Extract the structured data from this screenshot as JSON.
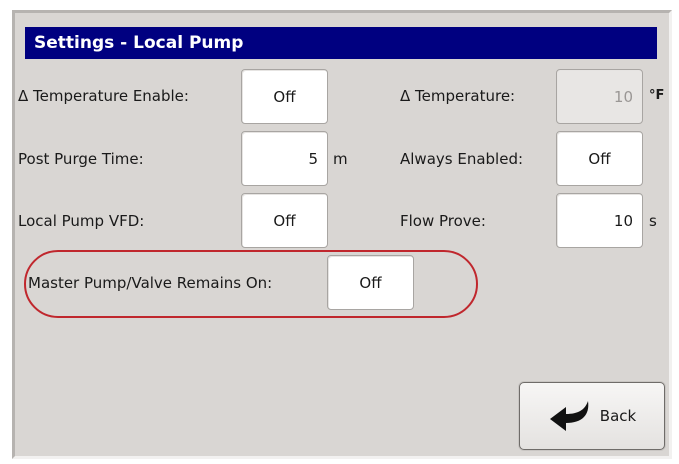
{
  "title": "Settings - Local Pump",
  "fields": {
    "delta_temp_enable": {
      "label": "Δ Temperature Enable:",
      "value": "Off"
    },
    "delta_temp": {
      "label": "Δ Temperature:",
      "value": "10",
      "unit": "°F"
    },
    "post_purge_time": {
      "label": "Post Purge Time:",
      "value": "5",
      "unit": "m"
    },
    "always_enabled": {
      "label": "Always Enabled:",
      "value": "Off"
    },
    "local_pump_vfd": {
      "label": "Local Pump VFD:",
      "value": "Off"
    },
    "flow_prove": {
      "label": "Flow Prove:",
      "value": "10",
      "unit": "s"
    },
    "master_pump_valve": {
      "label": "Master Pump/Valve Remains On:",
      "value": "Off"
    }
  },
  "back_button": {
    "label": "Back",
    "icon": "back-arrow-icon"
  },
  "colors": {
    "title_bg": "#000080",
    "panel_bg": "#d9d6d3",
    "highlight": "#c0272d"
  }
}
